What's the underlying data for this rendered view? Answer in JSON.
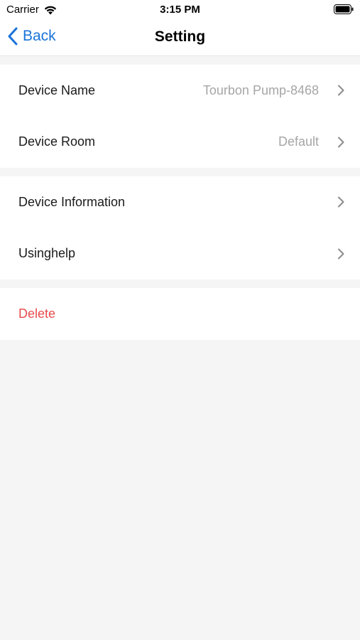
{
  "status_bar": {
    "carrier": "Carrier",
    "time": "3:15 PM",
    "wifi_icon": "wifi-icon",
    "battery_icon": "battery-icon"
  },
  "nav": {
    "back_label": "Back",
    "title": "Setting",
    "back_icon": "chevron-left-icon"
  },
  "groups": [
    {
      "items": [
        {
          "label": "Device Name",
          "value": "Tourbon Pump-8468"
        },
        {
          "label": "Device Room",
          "value": "Default"
        }
      ]
    },
    {
      "items": [
        {
          "label": "Device Information",
          "value": ""
        },
        {
          "label": "Usinghelp",
          "value": ""
        }
      ]
    },
    {
      "items": [
        {
          "label": "Delete"
        }
      ]
    }
  ],
  "colors": {
    "accent": "#1a73d9",
    "destructive": "#e74c4c",
    "secondary_text": "#a6a6a6",
    "background": "#f5f5f5"
  }
}
